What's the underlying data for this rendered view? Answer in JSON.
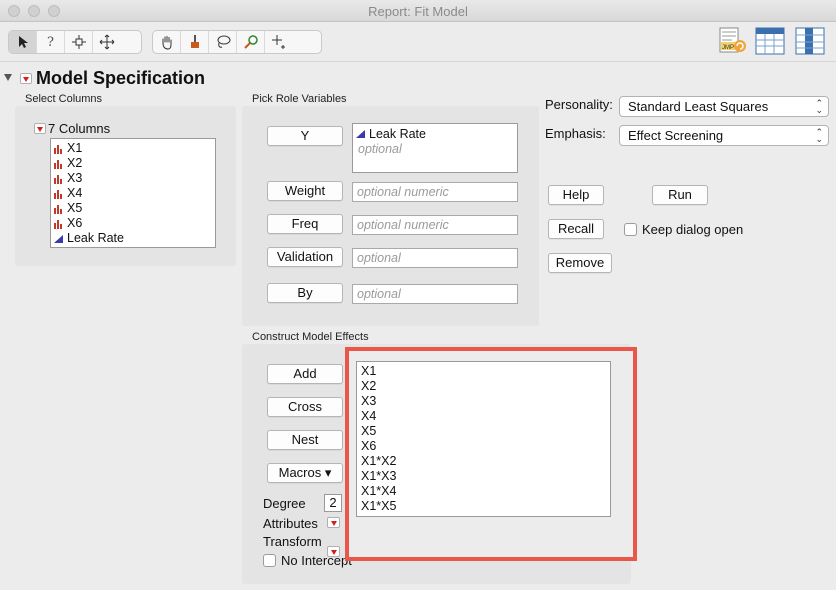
{
  "window": {
    "title": "Report: Fit Model"
  },
  "toolbar": {
    "tools": [
      {
        "icon": "arrow-icon",
        "glyph": "➤"
      },
      {
        "icon": "help-icon",
        "glyph": "?"
      },
      {
        "icon": "crosshair-icon",
        "glyph": "⌖"
      },
      {
        "icon": "move-icon",
        "glyph": "✥"
      },
      {
        "icon": "hand-icon",
        "glyph": "✋"
      },
      {
        "icon": "brush-icon",
        "glyph": "🖌"
      },
      {
        "icon": "lasso-icon",
        "glyph": "➰"
      },
      {
        "icon": "magnifier-icon",
        "glyph": "🔍"
      },
      {
        "icon": "crosshair-plus-icon",
        "glyph": "⌗"
      }
    ]
  },
  "model_spec": {
    "title": "Model Specification"
  },
  "select_columns": {
    "label": "Select Columns",
    "count_label": "7 Columns",
    "columns": [
      {
        "name": "X1",
        "type": "continuous"
      },
      {
        "name": "X2",
        "type": "continuous"
      },
      {
        "name": "X3",
        "type": "continuous"
      },
      {
        "name": "X4",
        "type": "continuous"
      },
      {
        "name": "X5",
        "type": "continuous"
      },
      {
        "name": "X6",
        "type": "continuous"
      },
      {
        "name": "Leak Rate",
        "type": "response"
      }
    ]
  },
  "roles": {
    "label": "Pick Role Variables",
    "y_button": "Y",
    "y_value": "Leak Rate",
    "y_placeholder": "optional",
    "weight_button": "Weight",
    "weight_placeholder": "optional numeric",
    "freq_button": "Freq",
    "freq_placeholder": "optional numeric",
    "validation_button": "Validation",
    "validation_placeholder": "optional",
    "by_button": "By",
    "by_placeholder": "optional"
  },
  "settings": {
    "personality_label": "Personality:",
    "personality_value": "Standard Least Squares",
    "emphasis_label": "Emphasis:",
    "emphasis_value": "Effect Screening"
  },
  "actions": {
    "help": "Help",
    "run": "Run",
    "recall": "Recall",
    "keep_open": "Keep dialog open",
    "remove": "Remove"
  },
  "effects": {
    "label": "Construct Model Effects",
    "add": "Add",
    "cross": "Cross",
    "nest": "Nest",
    "macros": "Macros ▾",
    "degree_label": "Degree",
    "degree_value": "2",
    "attributes_label": "Attributes",
    "transform_label": "Transform",
    "no_intercept_label": "No Intercept",
    "items": [
      "X1",
      "X2",
      "X3",
      "X4",
      "X5",
      "X6",
      "X1*X2",
      "X1*X3",
      "X1*X4",
      "X1*X5"
    ]
  },
  "colors": {
    "highlight": "#e8574a",
    "red_triangle": "#d21f1f",
    "response_icon": "#3a3aa8",
    "continuous_icon": "#c0392b"
  }
}
